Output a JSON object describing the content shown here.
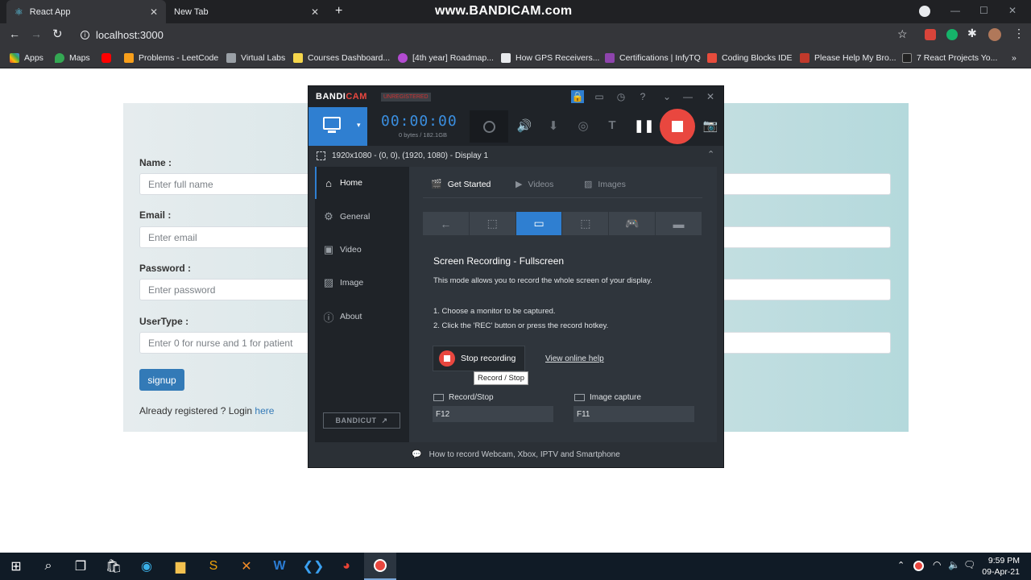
{
  "browser": {
    "tabs": [
      {
        "label": "React App",
        "active": true
      },
      {
        "label": "New Tab",
        "active": false
      }
    ],
    "watermark": "www.BANDICAM.com",
    "address": "localhost:3000",
    "bookmarks": [
      "Apps",
      "Maps",
      "Problems - LeetCode",
      "Virtual Labs",
      "Courses Dashboard...",
      "[4th year] Roadmap...",
      "How GPS Receivers...",
      "Certifications | InfyTQ",
      "Coding Blocks IDE",
      "Please Help My Bro...",
      "7 React Projects Yo..."
    ]
  },
  "form": {
    "name_label": "Name :",
    "name_placeholder": "Enter full name",
    "email_label": "Email :",
    "email_placeholder": "Enter email",
    "password_label": "Password :",
    "password_placeholder": "Enter password",
    "usertype_label": "UserType :",
    "usertype_placeholder": "Enter 0 for nurse and 1 for patient",
    "signup_label": "signup",
    "login_text": "Already registered ? Login ",
    "login_link": "here"
  },
  "bandicam": {
    "logo_band": "BANDI",
    "logo_cam": "CAM",
    "unregistered": "UNREGISTERED",
    "timer": "00:00:00",
    "bytes": "0 bytes / 182.1GB",
    "area": "1920x1080 - (0, 0), (1920, 1080) - Display 1",
    "sidebar": [
      "Home",
      "General",
      "Video",
      "Image",
      "About"
    ],
    "bandicut": "BANDICUT",
    "tabs": [
      "Get Started",
      "Videos",
      "Images"
    ],
    "mode_title": "Screen Recording - Fullscreen",
    "mode_desc": "This mode allows you to record the whole screen of your display.",
    "step1": "1. Choose a monitor to be captured.",
    "step2": "2. Click the 'REC' button or press the record hotkey.",
    "stop_label": "Stop recording",
    "help_link": "View online help",
    "tooltip": "Record / Stop",
    "hotkey_record_label": "Record/Stop",
    "hotkey_record_value": "F12",
    "hotkey_image_label": "Image capture",
    "hotkey_image_value": "F11",
    "footer": "How to record Webcam, Xbox, IPTV and Smartphone",
    "accent": "#2f7fd1",
    "record_color": "#e9473f"
  },
  "taskbar": {
    "time": "9:59 PM",
    "date": "09-Apr-21"
  }
}
